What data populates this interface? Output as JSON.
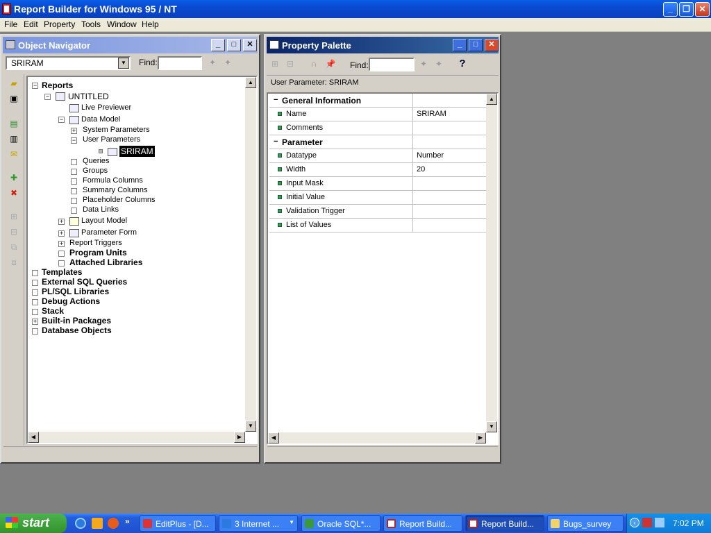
{
  "app": {
    "title": "Report Builder for Windows 95 / NT"
  },
  "menu": [
    "File",
    "Edit",
    "Property",
    "Tools",
    "Window",
    "Help"
  ],
  "navigator": {
    "title": "Object Navigator",
    "combo_value": "SRIRAM",
    "find_label": "Find:",
    "find_value": "",
    "tree": {
      "reports": "Reports",
      "untitled": "UNTITLED",
      "live_previewer": "Live Previewer",
      "data_model": "Data Model",
      "system_parameters": "System Parameters",
      "user_parameters": "User Parameters",
      "sriram": "SRIRAM",
      "queries": "Queries",
      "groups": "Groups",
      "formula_columns": "Formula Columns",
      "summary_columns": "Summary Columns",
      "placeholder_columns": "Placeholder Columns",
      "data_links": "Data Links",
      "layout_model": "Layout Model",
      "parameter_form": "Parameter Form",
      "report_triggers": "Report Triggers",
      "program_units": "Program Units",
      "attached_libraries": "Attached Libraries",
      "templates": "Templates",
      "external_sql": "External SQL Queries",
      "plsql_libraries": "PL/SQL Libraries",
      "debug_actions": "Debug Actions",
      "stack": "Stack",
      "builtin_packages": "Built-in Packages",
      "database_objects": "Database Objects"
    }
  },
  "palette": {
    "title": "Property Palette",
    "find_label": "Find:",
    "find_value": "",
    "help_label": "?",
    "context": "User Parameter: SRIRAM",
    "sections": {
      "general": "General Information",
      "parameter": "Parameter"
    },
    "rows": {
      "name": {
        "label": "Name",
        "value": "SRIRAM"
      },
      "comments": {
        "label": "Comments",
        "value": ""
      },
      "datatype": {
        "label": "Datatype",
        "value": "Number"
      },
      "width": {
        "label": "Width",
        "value": "20"
      },
      "input_mask": {
        "label": "Input Mask",
        "value": ""
      },
      "initial_value": {
        "label": "Initial Value",
        "value": ""
      },
      "validation_trigger": {
        "label": "Validation Trigger",
        "value": ""
      },
      "list_of_values": {
        "label": "List of Values",
        "value": ""
      }
    }
  },
  "taskbar": {
    "start": "start",
    "tasks": [
      "EditPlus - [D...",
      "3 Internet ...",
      "Oracle SQL*...",
      "Report Build...",
      "Report Build...",
      "Bugs_survey"
    ],
    "clock": "7:02 PM"
  },
  "colors": {
    "xp_title": "#0a49d1",
    "active_title": "#0a246a",
    "inactive_title": "#7a96df",
    "selection": "#000000"
  }
}
